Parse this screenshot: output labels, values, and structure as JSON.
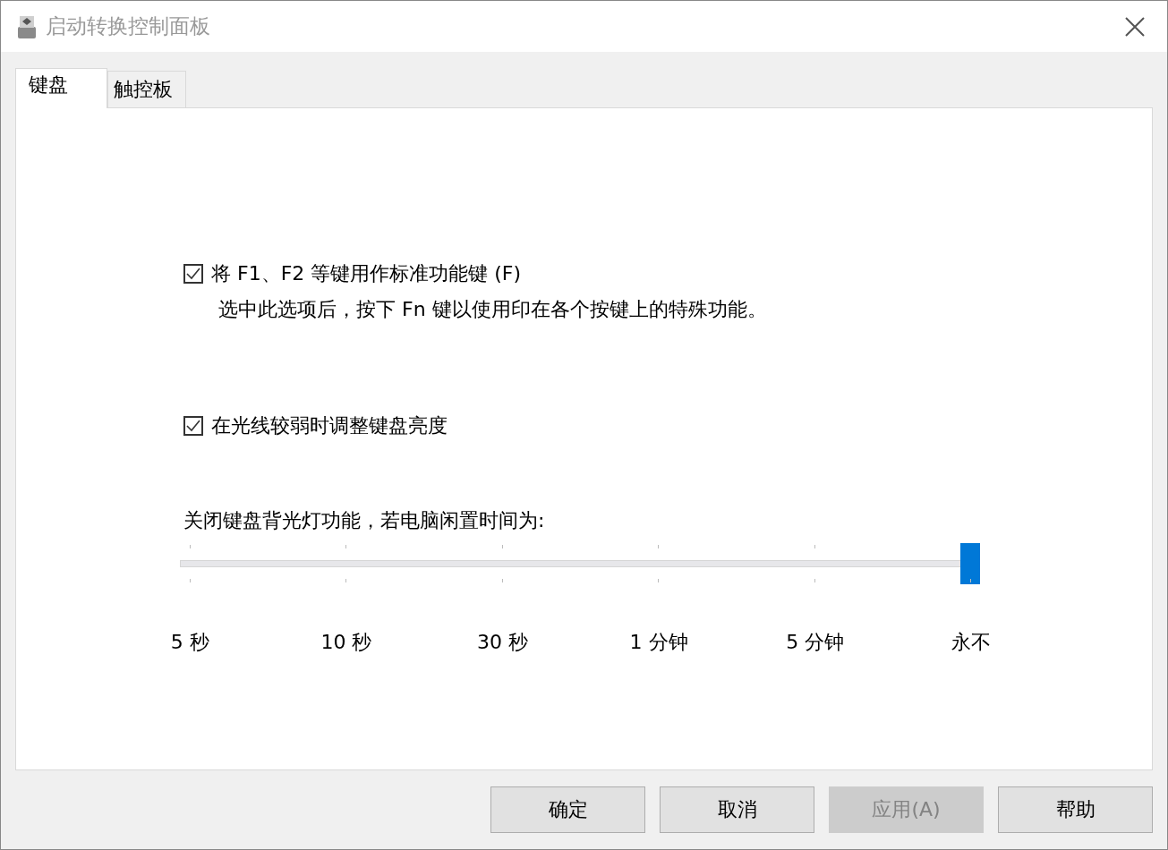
{
  "window": {
    "title": "启动转换控制面板"
  },
  "tabs": [
    {
      "label": "键盘",
      "selected": true
    },
    {
      "label": "触控板",
      "selected": false
    }
  ],
  "options": [
    {
      "label": "将 F1、F2 等键用作标准功能键 (F)",
      "description": "选中此选项后，按下 Fn 键以使用印在各个按键上的特殊功能。",
      "checked": true
    },
    {
      "label": "在光线较弱时调整键盘亮度",
      "checked": true
    }
  ],
  "backlight_slider": {
    "label": "关闭键盘背光灯功能，若电脑闲置时间为:",
    "level": 1,
    "tick_labels": [
      "5 秒",
      "10 秒",
      "30 秒",
      "1 分钟",
      "5 分钟",
      "永不"
    ]
  },
  "buttons": [
    {
      "label": "确定",
      "disabled": false
    },
    {
      "label": "取消",
      "disabled": false
    },
    {
      "label": "应用(A)",
      "disabled": true
    },
    {
      "label": "帮助",
      "disabled": false
    }
  ]
}
